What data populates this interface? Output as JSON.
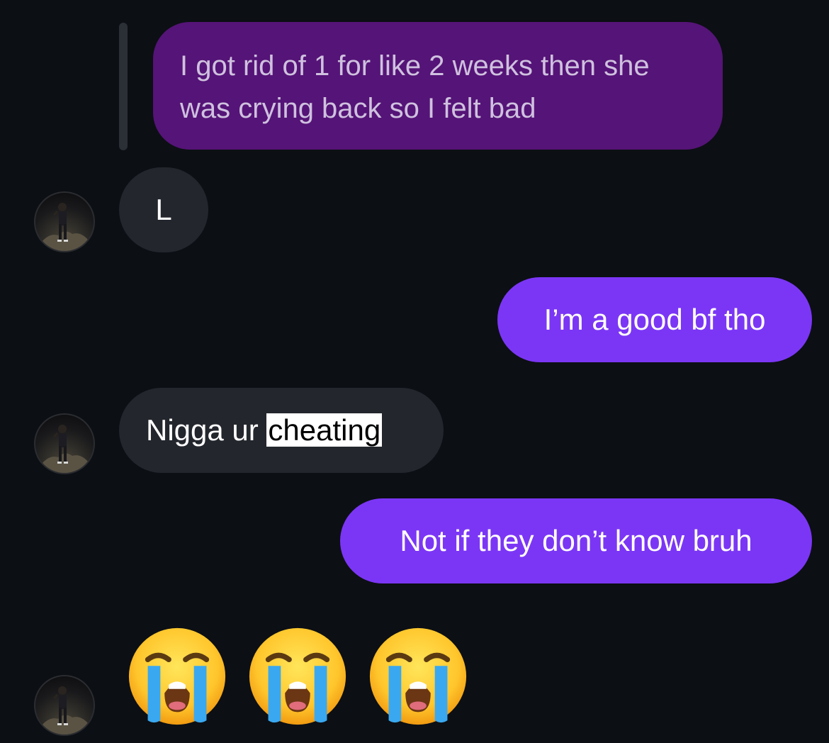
{
  "messages": [
    {
      "sender": "me",
      "type": "reply-quote",
      "lines": [
        "I got rid of 1 for like 2 weeks then she",
        "was crying back so I felt bad"
      ]
    },
    {
      "sender": "them",
      "text": "L"
    },
    {
      "sender": "me",
      "text": "I’m a good bf tho"
    },
    {
      "sender": "them",
      "text_before": "Nigga ur ",
      "highlight": "cheating"
    },
    {
      "sender": "me",
      "text": "Not if they don’t know bruh"
    },
    {
      "sender": "them",
      "type": "emoji",
      "emoji": [
        "😭",
        "😭",
        "😭"
      ],
      "emoji_name": "loudly-crying-face"
    }
  ],
  "colors": {
    "background": "#0c0f14",
    "outgoing_bubble": "#7b36f5",
    "quoted_bubble": "#551477",
    "incoming_bubble": "#23262d",
    "highlight": "#ffffff"
  }
}
